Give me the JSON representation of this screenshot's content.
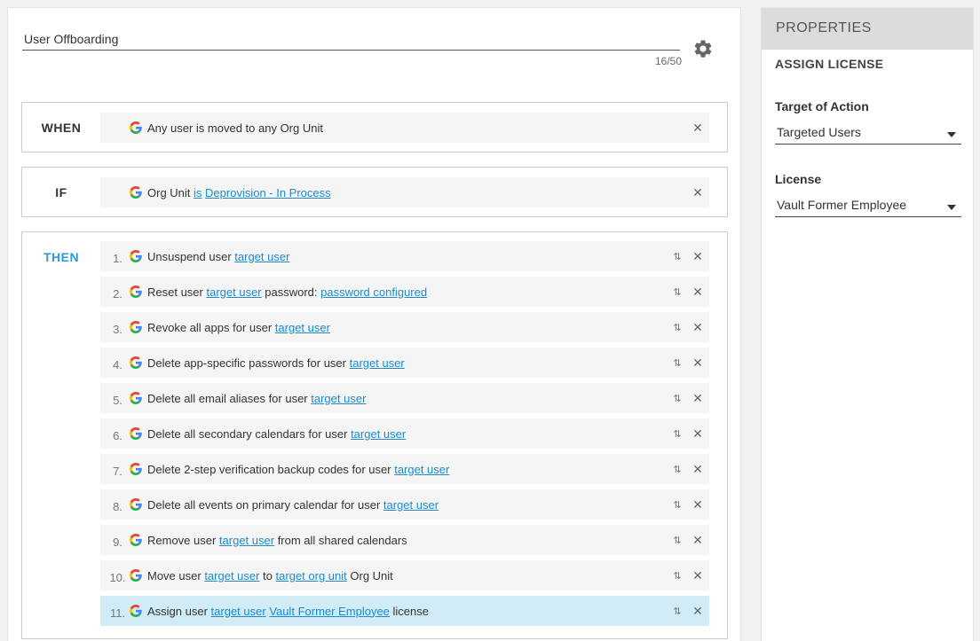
{
  "workflow": {
    "title": "User Offboarding",
    "counter": "16/50"
  },
  "when": {
    "label": "WHEN",
    "condition": {
      "parts": [
        {
          "t": "Any user is moved to any Org Unit"
        }
      ]
    }
  },
  "if": {
    "label": "IF",
    "condition": {
      "parts": [
        {
          "t": "Org Unit "
        },
        {
          "t": "is",
          "link": true
        },
        {
          "t": " "
        },
        {
          "t": "Deprovision - In Process",
          "link": true
        }
      ]
    }
  },
  "then": {
    "label": "THEN",
    "actions": [
      {
        "num": "1.",
        "parts": [
          {
            "t": "Unsuspend user "
          },
          {
            "t": "target user",
            "link": true
          }
        ]
      },
      {
        "num": "2.",
        "parts": [
          {
            "t": "Reset user "
          },
          {
            "t": "target user",
            "link": true
          },
          {
            "t": " password: "
          },
          {
            "t": "password configured",
            "link": true
          }
        ]
      },
      {
        "num": "3.",
        "parts": [
          {
            "t": "Revoke all apps for user "
          },
          {
            "t": "target user",
            "link": true
          }
        ]
      },
      {
        "num": "4.",
        "parts": [
          {
            "t": "Delete app-specific passwords for user "
          },
          {
            "t": "target user",
            "link": true
          }
        ]
      },
      {
        "num": "5.",
        "parts": [
          {
            "t": "Delete all email aliases for user "
          },
          {
            "t": "target user",
            "link": true
          }
        ]
      },
      {
        "num": "6.",
        "parts": [
          {
            "t": "Delete all secondary calendars for user "
          },
          {
            "t": "target user",
            "link": true
          }
        ]
      },
      {
        "num": "7.",
        "parts": [
          {
            "t": "Delete 2-step verification backup codes for user "
          },
          {
            "t": "target user",
            "link": true
          }
        ]
      },
      {
        "num": "8.",
        "parts": [
          {
            "t": "Delete all events on primary calendar for user "
          },
          {
            "t": "target user",
            "link": true
          }
        ]
      },
      {
        "num": "9.",
        "parts": [
          {
            "t": "Remove user "
          },
          {
            "t": "target user",
            "link": true
          },
          {
            "t": " from all shared calendars"
          }
        ]
      },
      {
        "num": "10.",
        "parts": [
          {
            "t": "Move user "
          },
          {
            "t": "target user",
            "link": true
          },
          {
            "t": " to "
          },
          {
            "t": "target org unit",
            "link": true
          },
          {
            "t": " Org Unit"
          }
        ]
      },
      {
        "num": "11.",
        "selected": true,
        "parts": [
          {
            "t": "Assign user "
          },
          {
            "t": "target user",
            "link": true
          },
          {
            "t": " "
          },
          {
            "t": "Vault Former Employee",
            "link": true
          },
          {
            "t": " license"
          }
        ]
      }
    ]
  },
  "properties": {
    "header": "PROPERTIES",
    "subtitle": "ASSIGN LICENSE",
    "target_label": "Target of Action",
    "target_value": "Targeted Users",
    "license_label": "License",
    "license_value": "Vault Former Employee"
  },
  "icons": {
    "gear": "gear-icon",
    "google": "google-g-icon",
    "reorder": "reorder-arrows-icon",
    "close": "close-icon",
    "dropdown": "chevron-down-icon"
  },
  "colors": {
    "link": "#1a8bcf",
    "then_label": "#2b9ad6",
    "selected_row": "#d1ecf7"
  }
}
